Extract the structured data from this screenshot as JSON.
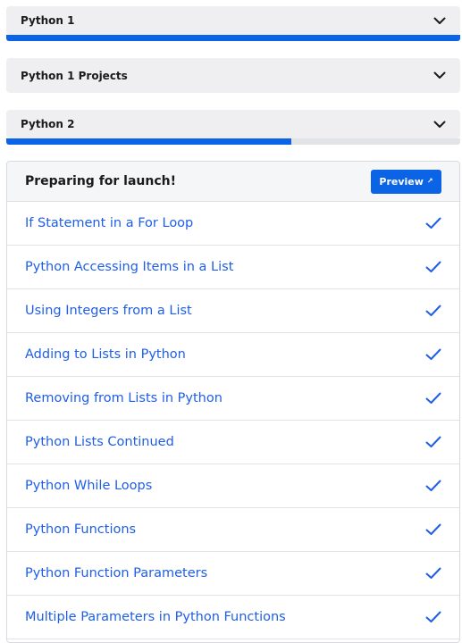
{
  "sections": [
    {
      "title": "Python 1",
      "progress": 1.0
    },
    {
      "title": "Python 1 Projects"
    },
    {
      "title": "Python 2",
      "progress": 0.627
    }
  ],
  "panel": {
    "title": "Preparing for launch!",
    "preview_label": "Preview",
    "preview_icon": "external-link-icon",
    "lessons": [
      {
        "label": "If Statement in a For Loop",
        "completed": true
      },
      {
        "label": "Python Accessing Items in a List",
        "completed": true
      },
      {
        "label": "Using Integers from a List",
        "completed": true
      },
      {
        "label": "Adding to Lists in Python",
        "completed": true
      },
      {
        "label": "Removing from Lists in Python",
        "completed": true
      },
      {
        "label": "Python Lists Continued",
        "completed": true
      },
      {
        "label": "Python While Loops",
        "completed": true
      },
      {
        "label": "Python Functions",
        "completed": true
      },
      {
        "label": "Python Function Parameters",
        "completed": true
      },
      {
        "label": "Multiple Parameters in Python Functions",
        "completed": true
      }
    ]
  },
  "colors": {
    "accent": "#0b63e6",
    "link": "#1f5ee8",
    "header_bg": "#efeff1"
  }
}
